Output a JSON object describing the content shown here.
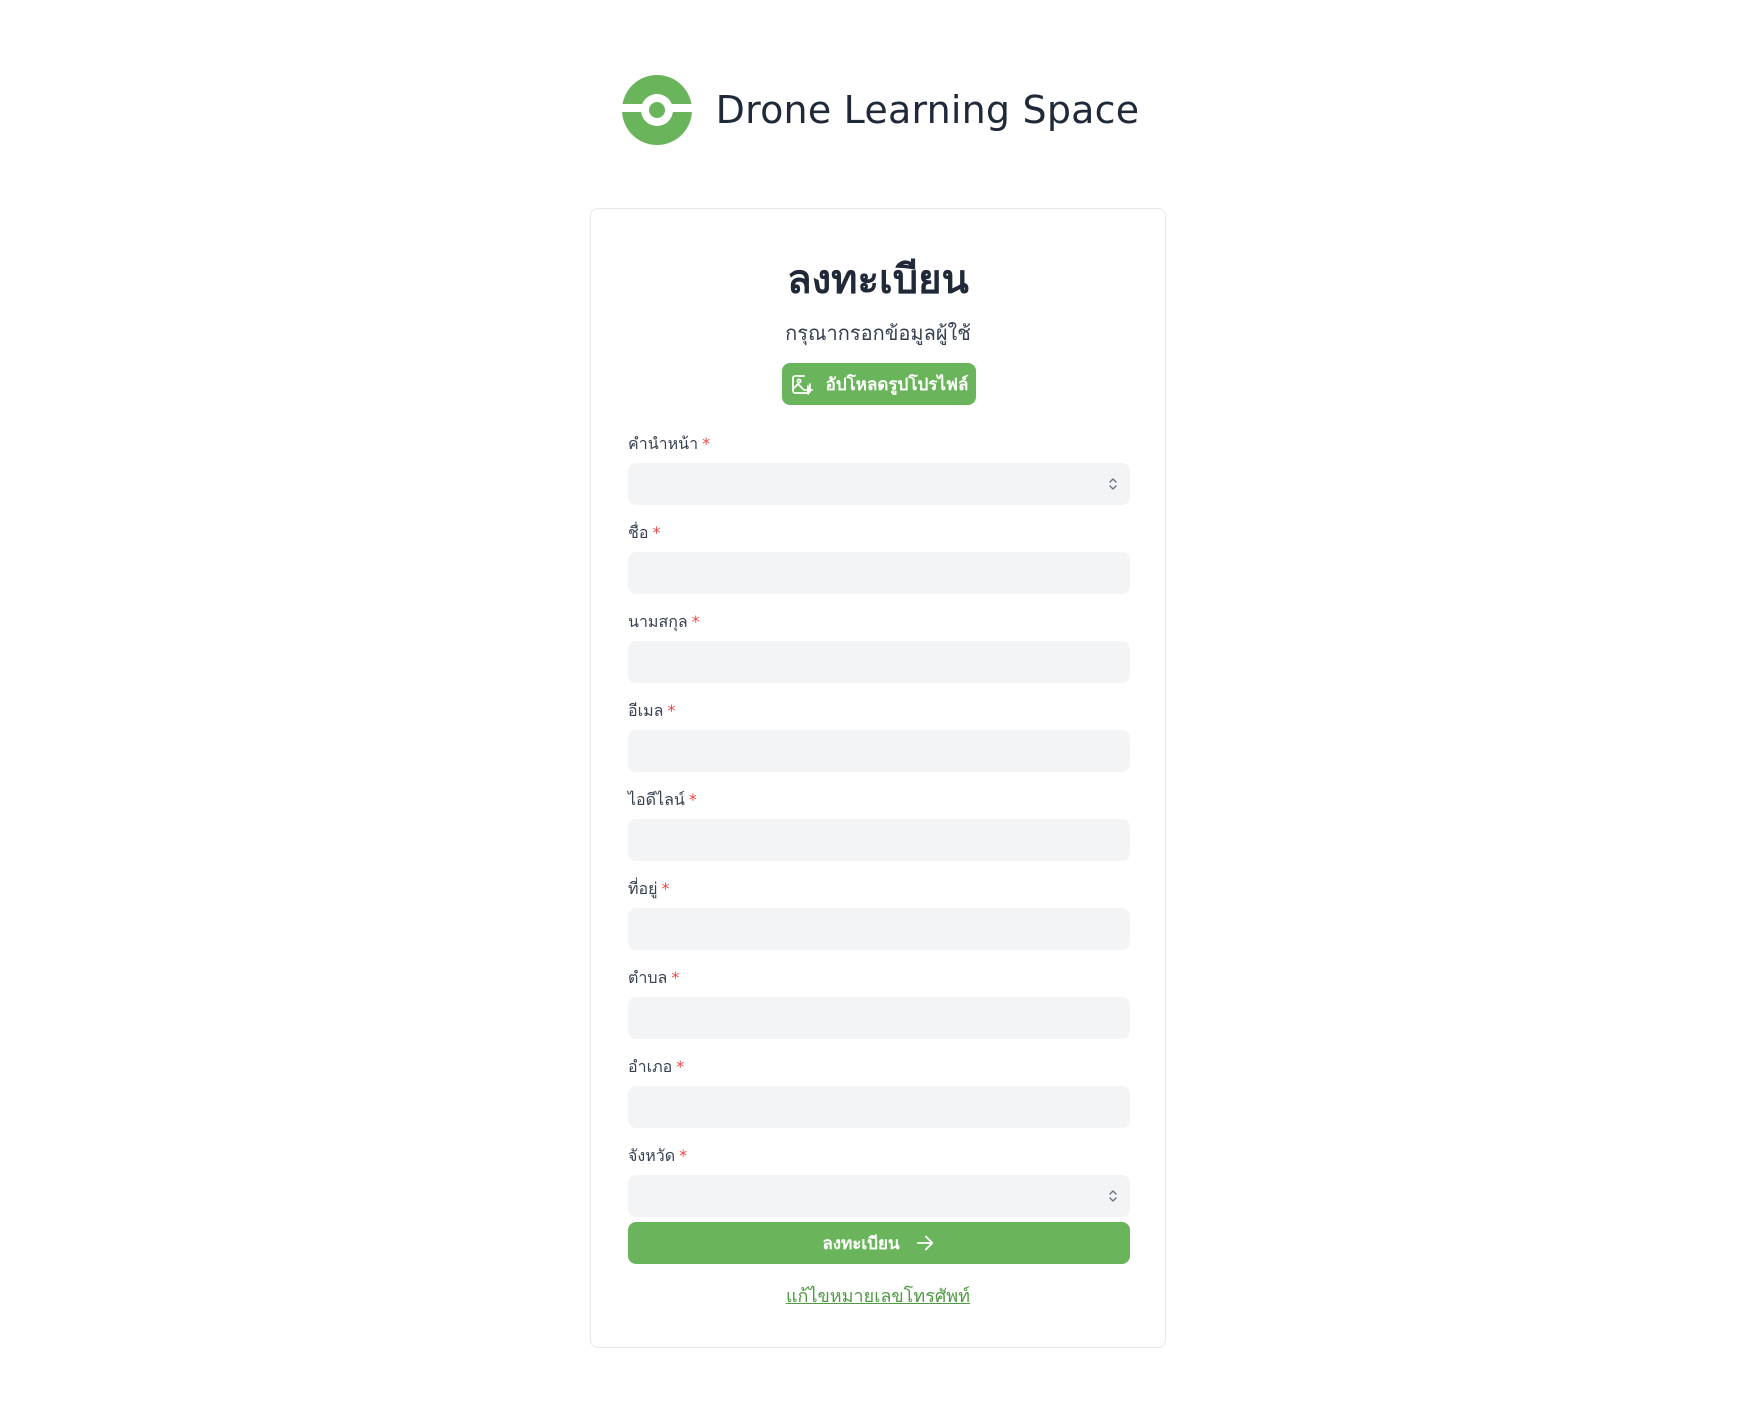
{
  "header": {
    "brand": "Drone Learning Space",
    "logo_icon": "drone-logo-icon"
  },
  "colors": {
    "accent": "#6ab55b",
    "link": "#4f9a43",
    "required": "#ef4444",
    "field_bg": "#f3f4f6"
  },
  "form": {
    "title": "ลงทะเบียน",
    "subtitle": "กรุณากรอกข้อมูลผู้ใช้",
    "upload_label": "อัปโหลดรูปโปรไฟล์",
    "upload_icon": "image-plus-icon",
    "required_mark": "*",
    "fields": [
      {
        "label": "คำนำหน้า",
        "type": "select",
        "value": ""
      },
      {
        "label": "ชื่อ",
        "type": "text",
        "value": ""
      },
      {
        "label": "นามสกุล",
        "type": "text",
        "value": ""
      },
      {
        "label": "อีเมล",
        "type": "text",
        "value": ""
      },
      {
        "label": "ไอดีไลน์",
        "type": "text",
        "value": ""
      },
      {
        "label": "ที่อยู่",
        "type": "text",
        "value": ""
      },
      {
        "label": "ตำบล",
        "type": "text",
        "value": ""
      },
      {
        "label": "อำเภอ",
        "type": "text",
        "value": ""
      },
      {
        "label": "จังหวัด",
        "type": "select",
        "value": ""
      }
    ],
    "submit_label": "ลงทะเบียน",
    "submit_icon": "arrow-right-icon",
    "edit_phone_link": "แก้ไขหมายเลขโทรศัพท์"
  }
}
